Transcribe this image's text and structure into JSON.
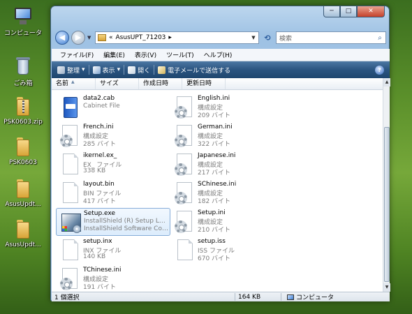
{
  "desktop": {
    "icons": [
      {
        "label": "コンピュータ",
        "icon": "computer-icon"
      },
      {
        "label": "ごみ箱",
        "icon": "recycle-bin-icon"
      },
      {
        "label": "PSK0603.zip",
        "icon": "zip-folder-icon"
      },
      {
        "label": "PSK0603",
        "icon": "folder-icon"
      },
      {
        "label": "AsusUpdt...",
        "icon": "folder-icon"
      },
      {
        "label": "AsusUpdt...",
        "icon": "folder-icon"
      }
    ]
  },
  "window": {
    "buttons": {
      "minimize": "─",
      "maximize": "□",
      "close": "✕"
    },
    "address": {
      "prefix": "«",
      "path": "AsusUPT_71203",
      "arrow": "▸"
    },
    "search": {
      "placeholder": "検索"
    },
    "menu": [
      "ファイル(F)",
      "編集(E)",
      "表示(V)",
      "ツール(T)",
      "ヘルプ(H)"
    ],
    "toolbar": {
      "organize": "整理",
      "views": "表示",
      "open": "開く",
      "email": "電子メールで送信する",
      "dropdown": "▾",
      "help": "?"
    },
    "columns": [
      "名前",
      "サイズ",
      "作成日時",
      "更新日時"
    ],
    "files": [
      {
        "name": "data2.cab",
        "type": "Cabinet File",
        "size": "",
        "icon": "cab-icon",
        "selected": false
      },
      {
        "name": "English.ini",
        "type": "構成設定",
        "size": "209 バイト",
        "icon": "ini-config-icon",
        "selected": false
      },
      {
        "name": "French.ini",
        "type": "構成設定",
        "size": "285 バイト",
        "icon": "ini-config-icon",
        "selected": false
      },
      {
        "name": "German.ini",
        "type": "構成設定",
        "size": "322 バイト",
        "icon": "ini-config-icon",
        "selected": false
      },
      {
        "name": "ikernel.ex_",
        "type": "EX_ ファイル",
        "size": "338 KB",
        "icon": "blank-file-icon",
        "selected": false
      },
      {
        "name": "Japanese.ini",
        "type": "構成設定",
        "size": "217 バイト",
        "icon": "ini-config-icon",
        "selected": false
      },
      {
        "name": "layout.bin",
        "type": "BIN ファイル",
        "size": "417 バイト",
        "icon": "blank-file-icon",
        "selected": false
      },
      {
        "name": "SChinese.ini",
        "type": "構成設定",
        "size": "182 バイト",
        "icon": "ini-config-icon",
        "selected": false
      },
      {
        "name": "Setup.exe",
        "type": "InstallShield (R) Setup Launcher",
        "size": "InstallShield Software Corporation",
        "icon": "installshield-setup-icon",
        "selected": true
      },
      {
        "name": "Setup.ini",
        "type": "構成設定",
        "size": "210 バイト",
        "icon": "ini-config-icon",
        "selected": false
      },
      {
        "name": "setup.inx",
        "type": "INX ファイル",
        "size": "140 KB",
        "icon": "blank-file-icon",
        "selected": false
      },
      {
        "name": "setup.iss",
        "type": "ISS ファイル",
        "size": "670 バイト",
        "icon": "blank-file-icon",
        "selected": false
      },
      {
        "name": "TChinese.ini",
        "type": "構成設定",
        "size": "191 バイト",
        "icon": "ini-config-icon",
        "selected": false
      }
    ],
    "status": {
      "selection": "1 個選択",
      "size": "164 KB",
      "zone": "コンピュータ"
    }
  },
  "colors": {
    "toolbar": "#2b5480",
    "selection": "#dcecfc",
    "desktop": "#5a8f2a"
  }
}
